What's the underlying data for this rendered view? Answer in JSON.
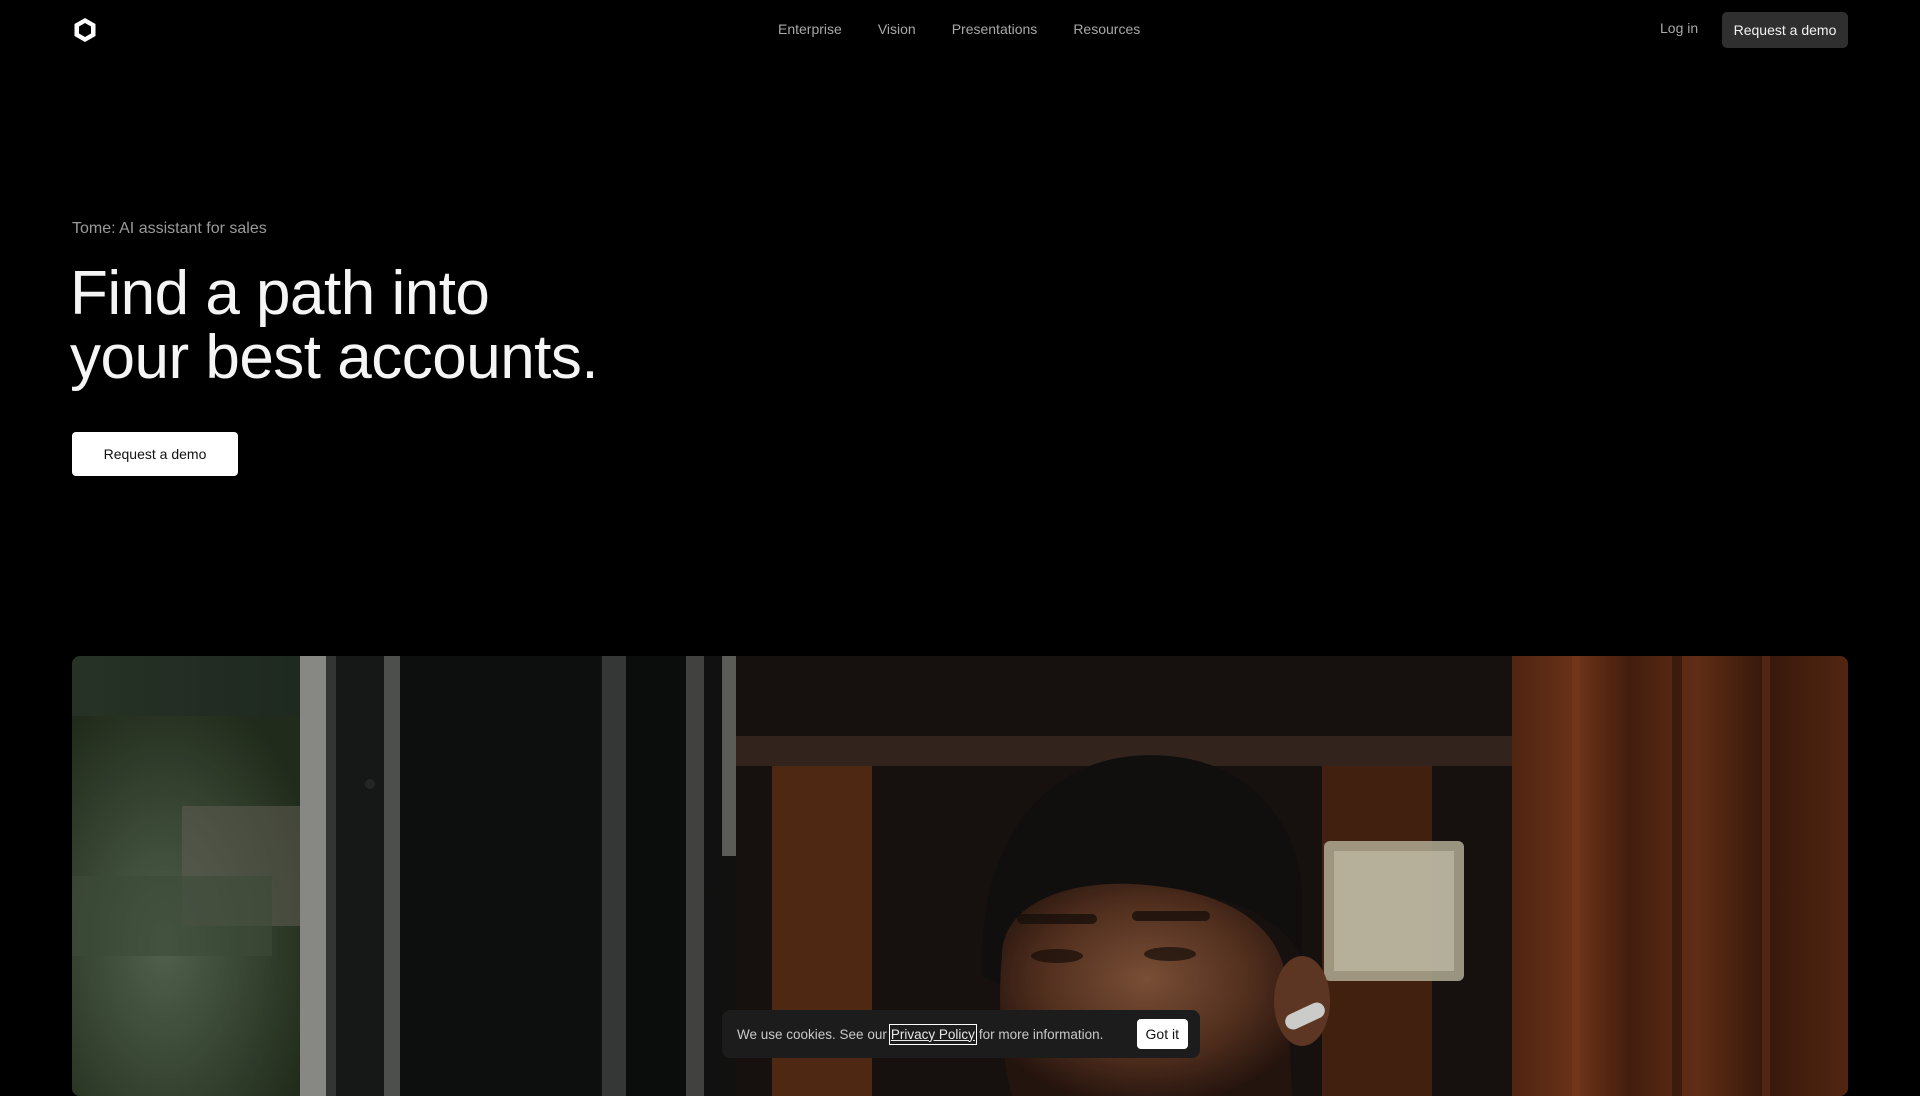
{
  "header": {
    "logo_icon": "tome-logo-icon",
    "nav": [
      {
        "label": "Enterprise"
      },
      {
        "label": "Vision"
      },
      {
        "label": "Presentations"
      },
      {
        "label": "Resources"
      }
    ],
    "login_label": "Log in",
    "cta_label": "Request a demo"
  },
  "hero": {
    "eyebrow": "Tome: AI assistant for sales",
    "headline_line1": "Find a path into",
    "headline_line2": "your best accounts.",
    "cta_label": "Request a demo"
  },
  "cookie_banner": {
    "text_before": "We use cookies. See our",
    "link_label": "Privacy Policy",
    "text_after": "for more information.",
    "accept_label": "Got it"
  },
  "colors": {
    "background": "#000000",
    "nav_text": "#a8a8a8",
    "cta_dark": "#2f2f2f",
    "cta_light": "#ffffff"
  }
}
